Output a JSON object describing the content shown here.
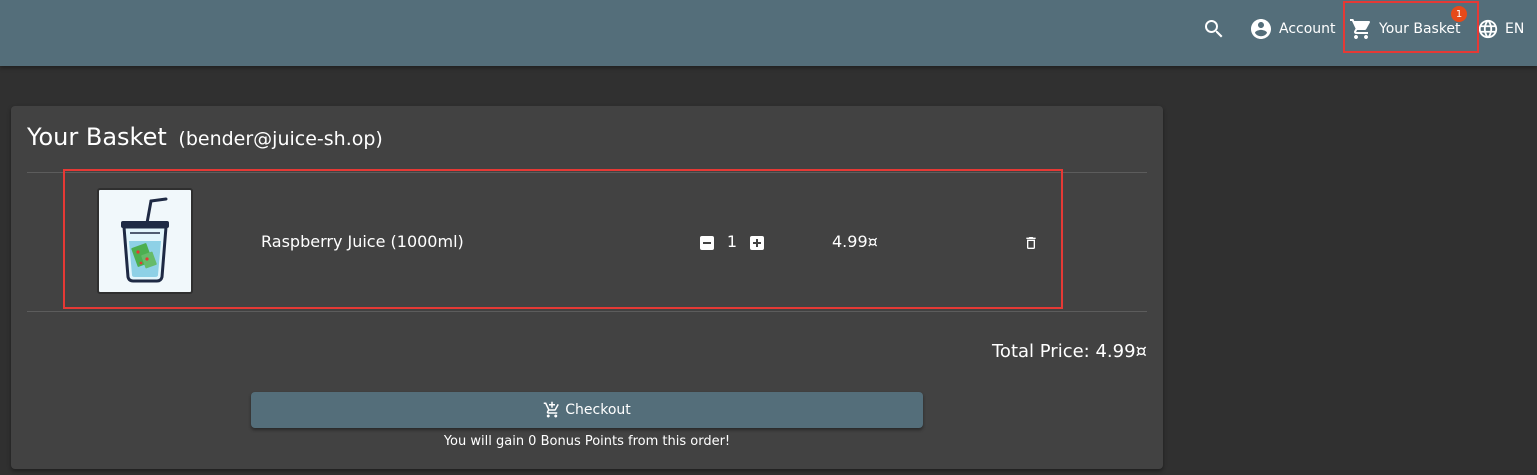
{
  "toolbar": {
    "search_icon": "search-icon",
    "account_label": "Account",
    "basket_label": "Your Basket",
    "basket_count": "1",
    "language_label": "EN"
  },
  "basket": {
    "title": "Your Basket",
    "user": "(bender@juice-sh.op)",
    "items": [
      {
        "name": "Raspberry Juice (1000ml)",
        "quantity": "1",
        "price": "4.99¤",
        "image_icon": "juice-cup-icon"
      }
    ],
    "total_price": "Total Price: 4.99¤",
    "checkout_label": "Checkout",
    "bonus_text": "You will gain 0 Bonus Points from this order!"
  },
  "colors": {
    "toolbar": "#546e7a",
    "background": "#303030",
    "card": "#424242",
    "badge": "#e64a19",
    "highlight": "#e53935"
  }
}
